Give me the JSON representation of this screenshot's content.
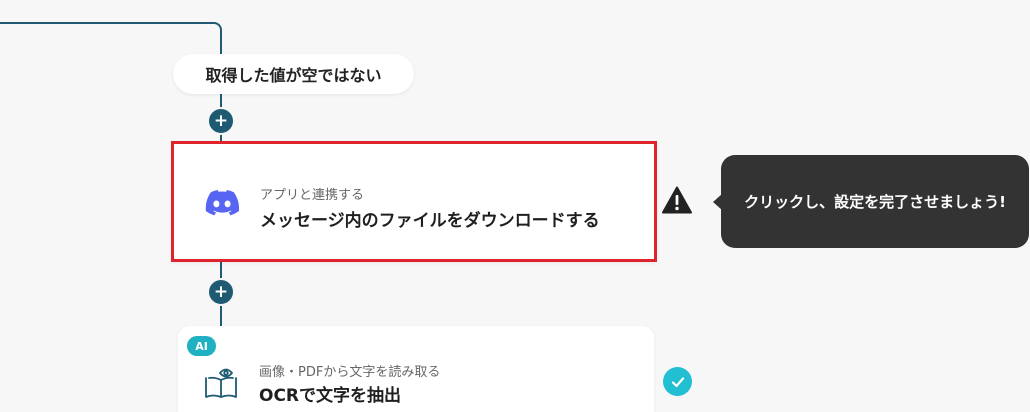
{
  "condition": {
    "label": "取得した値が空ではない"
  },
  "steps": [
    {
      "subtitle": "アプリと連携する",
      "title": "メッセージ内のファイルをダウンロードする",
      "icon": "discord-icon",
      "status": "warning",
      "highlighted": true
    },
    {
      "badge": "AI",
      "subtitle": "画像・PDFから文字を読み取る",
      "title": "OCRで文字を抽出",
      "icon": "book-scan-icon",
      "status": "complete"
    }
  ],
  "tooltip": {
    "text": "クリックし、設定を完了させましょう!"
  },
  "colors": {
    "connector": "#1f5a73",
    "highlight_border": "#e0242b",
    "discord": "#5865f2",
    "ai_badge": "#1fb0c2",
    "check": "#22bed2",
    "tooltip_bg": "#333333"
  }
}
